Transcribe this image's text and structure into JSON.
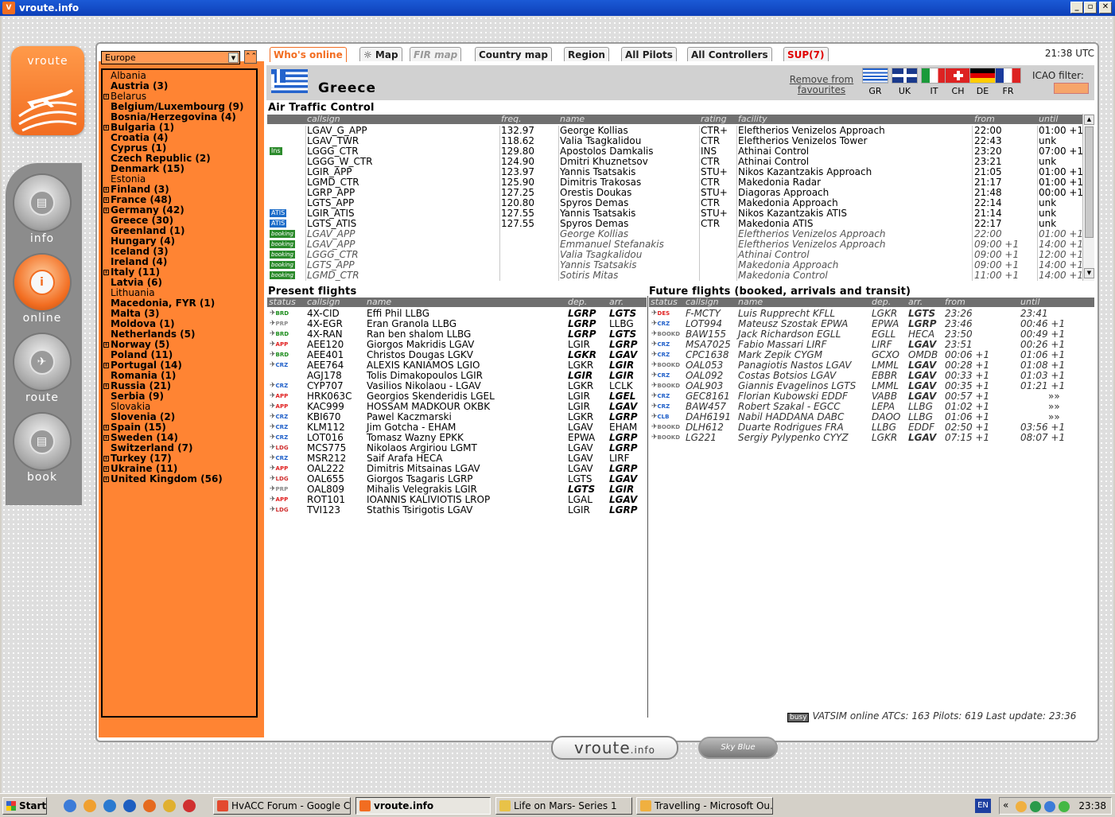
{
  "window": {
    "title": "vroute.info",
    "app_icon": "V"
  },
  "logo_text": "vroute",
  "nav": [
    {
      "label": "info",
      "glyph": "▤"
    },
    {
      "label": "online",
      "glyph": "i"
    },
    {
      "label": "route",
      "glyph": "✈"
    },
    {
      "label": "book",
      "glyph": "▤"
    }
  ],
  "region": {
    "selected": "Europe"
  },
  "regions": [
    {
      "name": "Albania",
      "bold": false,
      "exp": false
    },
    {
      "name": "Austria (3)",
      "bold": true,
      "exp": false
    },
    {
      "name": "Belarus",
      "bold": false,
      "exp": true
    },
    {
      "name": "Belgium/Luxembourg (9)",
      "bold": true,
      "exp": false
    },
    {
      "name": "Bosnia/Herzegovina (4)",
      "bold": true,
      "exp": false
    },
    {
      "name": "Bulgaria (1)",
      "bold": true,
      "exp": true
    },
    {
      "name": "Croatia (4)",
      "bold": true,
      "exp": false
    },
    {
      "name": "Cyprus (1)",
      "bold": true,
      "exp": false
    },
    {
      "name": "Czech Republic (2)",
      "bold": true,
      "exp": false
    },
    {
      "name": "Denmark (15)",
      "bold": true,
      "exp": false
    },
    {
      "name": "Estonia",
      "bold": false,
      "exp": false
    },
    {
      "name": "Finland (3)",
      "bold": true,
      "exp": true
    },
    {
      "name": "France (48)",
      "bold": true,
      "exp": true
    },
    {
      "name": "Germany (42)",
      "bold": true,
      "exp": true
    },
    {
      "name": "Greece (30)",
      "bold": true,
      "exp": false
    },
    {
      "name": "Greenland (1)",
      "bold": true,
      "exp": false
    },
    {
      "name": "Hungary (4)",
      "bold": true,
      "exp": false
    },
    {
      "name": "Iceland (3)",
      "bold": true,
      "exp": false
    },
    {
      "name": "Ireland (4)",
      "bold": true,
      "exp": false
    },
    {
      "name": "Italy (11)",
      "bold": true,
      "exp": true
    },
    {
      "name": "Latvia (6)",
      "bold": true,
      "exp": false
    },
    {
      "name": "Lithuania",
      "bold": false,
      "exp": false
    },
    {
      "name": "Macedonia, FYR (1)",
      "bold": true,
      "exp": false
    },
    {
      "name": "Malta (3)",
      "bold": true,
      "exp": false
    },
    {
      "name": "Moldova (1)",
      "bold": true,
      "exp": false
    },
    {
      "name": "Netherlands (5)",
      "bold": true,
      "exp": false
    },
    {
      "name": "Norway (5)",
      "bold": true,
      "exp": true
    },
    {
      "name": "Poland (11)",
      "bold": true,
      "exp": false
    },
    {
      "name": "Portugal (14)",
      "bold": true,
      "exp": true
    },
    {
      "name": "Romania (1)",
      "bold": true,
      "exp": false
    },
    {
      "name": "Russia (21)",
      "bold": true,
      "exp": true
    },
    {
      "name": "Serbia (9)",
      "bold": true,
      "exp": false
    },
    {
      "name": "Slovakia",
      "bold": false,
      "exp": false
    },
    {
      "name": "Slovenia (2)",
      "bold": true,
      "exp": false
    },
    {
      "name": "Spain (15)",
      "bold": true,
      "exp": true
    },
    {
      "name": "Sweden (14)",
      "bold": true,
      "exp": true
    },
    {
      "name": "Switzerland (7)",
      "bold": true,
      "exp": false
    },
    {
      "name": "Turkey (17)",
      "bold": true,
      "exp": true
    },
    {
      "name": "Ukraine (11)",
      "bold": true,
      "exp": true
    },
    {
      "name": "United Kingdom (56)",
      "bold": true,
      "exp": true
    }
  ],
  "tabs": [
    {
      "label": "Who's online",
      "state": "act"
    },
    {
      "label": "☼ Map",
      "state": ""
    },
    {
      "label": "FIR map",
      "state": "dis"
    },
    {
      "label": "Country map",
      "state": ""
    },
    {
      "label": "Region",
      "state": ""
    },
    {
      "label": "All Pilots",
      "state": ""
    },
    {
      "label": "All Controllers",
      "state": ""
    },
    {
      "label": "SUP(7)",
      "state": "sup"
    }
  ],
  "utc": "21:38 UTC",
  "header": {
    "country": "Greece",
    "remove": "Remove from favourites",
    "icao_label": "ICAO filter:",
    "favourites": [
      {
        "code": "GR"
      },
      {
        "code": "UK"
      },
      {
        "code": "IT"
      },
      {
        "code": "CH"
      },
      {
        "code": "DE"
      },
      {
        "code": "FR"
      }
    ]
  },
  "atc": {
    "title": "Air Traffic Control",
    "columns": [
      "callsign",
      "freq.",
      "name",
      "rating",
      "facility",
      "from",
      "until"
    ],
    "rows": [
      {
        "badge": "",
        "callsign": "LGAV_G_APP",
        "freq": "132.97",
        "name": "George Kollias",
        "rating": "CTR+",
        "facility": "Eleftherios Venizelos Approach",
        "from": "22:00",
        "until": "01:00 +1",
        "booking": false
      },
      {
        "badge": "",
        "callsign": "LGAV_TWR",
        "freq": "118.62",
        "name": "Valia Tsagkalidou",
        "rating": "CTR",
        "facility": "Eleftherios Venizelos Tower",
        "from": "22:43",
        "until": "unk",
        "booking": false
      },
      {
        "badge": "Ins",
        "callsign": "LGGG_CTR",
        "freq": "129.80",
        "name": "Apostolos Damkalis",
        "rating": "INS",
        "facility": "Athinai Control",
        "from": "23:20",
        "until": "07:00 +1",
        "booking": false
      },
      {
        "badge": "",
        "callsign": "LGGG_W_CTR",
        "freq": "124.90",
        "name": "Dmitri Khuznetsov",
        "rating": "CTR",
        "facility": "Athinai Control",
        "from": "23:21",
        "until": "unk",
        "booking": false
      },
      {
        "badge": "",
        "callsign": "LGIR_APP",
        "freq": "123.97",
        "name": "Yannis Tsatsakis",
        "rating": "STU+",
        "facility": "Nikos Kazantzakis Approach",
        "from": "21:05",
        "until": "01:00 +1",
        "booking": false
      },
      {
        "badge": "",
        "callsign": "LGMD_CTR",
        "freq": "125.90",
        "name": "Dimitris Trakosas",
        "rating": "CTR",
        "facility": "Makedonia Radar",
        "from": "21:17",
        "until": "01:00 +1",
        "booking": false
      },
      {
        "badge": "",
        "callsign": "LGRP_APP",
        "freq": "127.25",
        "name": "Orestis Doukas",
        "rating": "STU+",
        "facility": "Diagoras Approach",
        "from": "21:48",
        "until": "00:00 +1",
        "booking": false
      },
      {
        "badge": "",
        "callsign": "LGTS_APP",
        "freq": "120.80",
        "name": "Spyros Demas",
        "rating": "CTR",
        "facility": "Makedonia Approach",
        "from": "22:14",
        "until": "unk",
        "booking": false
      },
      {
        "badge": "ATIS",
        "callsign": "LGIR_ATIS",
        "freq": "127.55",
        "name": "Yannis Tsatsakis",
        "rating": "STU+",
        "facility": "Nikos Kazantzakis ATIS",
        "from": "21:14",
        "until": "unk",
        "booking": false
      },
      {
        "badge": "ATIS",
        "callsign": "LGTS_ATIS",
        "freq": "127.55",
        "name": "Spyros Demas",
        "rating": "CTR",
        "facility": "Makedonia ATIS",
        "from": "22:17",
        "until": "unk",
        "booking": false
      },
      {
        "badge": "booking",
        "callsign": "LGAV_APP",
        "freq": "",
        "name": "George Kollias",
        "rating": "",
        "facility": "Eleftherios Venizelos Approach",
        "from": "22:00",
        "until": "01:00 +1",
        "booking": true
      },
      {
        "badge": "booking",
        "callsign": "LGAV_APP",
        "freq": "",
        "name": "Emmanuel Stefanakis",
        "rating": "",
        "facility": "Eleftherios Venizelos Approach",
        "from": "09:00 +1",
        "until": "14:00 +1",
        "booking": true
      },
      {
        "badge": "booking",
        "callsign": "LGGG_CTR",
        "freq": "",
        "name": "Valia Tsagkalidou",
        "rating": "",
        "facility": "Athinai Control",
        "from": "09:00 +1",
        "until": "12:00 +1",
        "booking": true
      },
      {
        "badge": "booking",
        "callsign": "LGTS_APP",
        "freq": "",
        "name": "Yannis Tsatsakis",
        "rating": "",
        "facility": "Makedonia Approach",
        "from": "09:00 +1",
        "until": "14:00 +1",
        "booking": true
      },
      {
        "badge": "booking",
        "callsign": "LGMD_CTR",
        "freq": "",
        "name": "Sotiris Mitas",
        "rating": "",
        "facility": "Makedonia Control",
        "from": "11:00 +1",
        "until": "14:00 +1",
        "booking": true
      }
    ]
  },
  "present": {
    "title": "Present flights",
    "columns": [
      "status",
      "callsign",
      "name",
      "dep.",
      "arr."
    ],
    "rows": [
      {
        "status": "BRD",
        "callsign": "4X-CID",
        "name": "Effi Phil LLBG",
        "dep": "LGRP",
        "arr": "LGTS",
        "depb": true,
        "arrb": true
      },
      {
        "status": "PRP",
        "callsign": "4X-EGR",
        "name": "Eran Granola LLBG",
        "dep": "LGRP",
        "arr": "LLBG",
        "depb": true,
        "arrb": false
      },
      {
        "status": "BRD",
        "callsign": "4X-RAN",
        "name": "Ran ben shalom LLBG",
        "dep": "LGRP",
        "arr": "LGTS",
        "depb": true,
        "arrb": true
      },
      {
        "status": "APP",
        "callsign": "AEE120",
        "name": "Giorgos Makridis LGAV",
        "dep": "LGIR",
        "arr": "LGRP",
        "depb": false,
        "arrb": true
      },
      {
        "status": "BRD",
        "callsign": "AEE401",
        "name": "Christos Dougas LGKV",
        "dep": "LGKR",
        "arr": "LGAV",
        "depb": true,
        "arrb": true
      },
      {
        "status": "CRZ",
        "callsign": "AEE764",
        "name": "ALEXIS KANIAMOS LGIO",
        "dep": "LGKR",
        "arr": "LGIR",
        "depb": false,
        "arrb": true
      },
      {
        "status": "",
        "callsign": "AGJ178",
        "name": "Tolis Dimakopoulos LGIR",
        "dep": "LGIR",
        "arr": "LGIR",
        "depb": true,
        "arrb": true
      },
      {
        "status": "CRZ",
        "callsign": "CYP707",
        "name": "Vasilios Nikolaou - LGAV",
        "dep": "LGKR",
        "arr": "LCLK",
        "depb": false,
        "arrb": false
      },
      {
        "status": "APP",
        "callsign": "HRK063C",
        "name": "Georgios Skenderidis LGEL",
        "dep": "LGIR",
        "arr": "LGEL",
        "depb": false,
        "arrb": true
      },
      {
        "status": "APP",
        "callsign": "KAC999",
        "name": "HOSSAM MADKOUR OKBK",
        "dep": "LGIR",
        "arr": "LGAV",
        "depb": false,
        "arrb": true
      },
      {
        "status": "CRZ",
        "callsign": "KBI670",
        "name": "Pawel Kaczmarski",
        "dep": "LGKR",
        "arr": "LGRP",
        "depb": false,
        "arrb": true
      },
      {
        "status": "CRZ",
        "callsign": "KLM112",
        "name": "Jim Gotcha - EHAM",
        "dep": "LGAV",
        "arr": "EHAM",
        "depb": false,
        "arrb": false
      },
      {
        "status": "CRZ",
        "callsign": "LOT016",
        "name": "Tomasz Wazny EPKK",
        "dep": "EPWA",
        "arr": "LGRP",
        "depb": false,
        "arrb": true
      },
      {
        "status": "LDG",
        "callsign": "MCS775",
        "name": "Nikolaos Argiriou LGMT",
        "dep": "LGAV",
        "arr": "LGRP",
        "depb": false,
        "arrb": true
      },
      {
        "status": "CRZ",
        "callsign": "MSR212",
        "name": "Saif Arafa HECA",
        "dep": "LGAV",
        "arr": "LIRF",
        "depb": false,
        "arrb": false
      },
      {
        "status": "APP",
        "callsign": "OAL222",
        "name": "Dimitris Mitsainas LGAV",
        "dep": "LGAV",
        "arr": "LGRP",
        "depb": false,
        "arrb": true
      },
      {
        "status": "LDG",
        "callsign": "OAL655",
        "name": "Giorgos Tsagaris LGRP",
        "dep": "LGTS",
        "arr": "LGAV",
        "depb": false,
        "arrb": true
      },
      {
        "status": "PRP",
        "callsign": "OAL809",
        "name": "Mihalis Velegrakis LGIR",
        "dep": "LGTS",
        "arr": "LGIR",
        "depb": true,
        "arrb": true
      },
      {
        "status": "APP",
        "callsign": "ROT101",
        "name": "IOANNIS KALIVIOTIS LROP",
        "dep": "LGAL",
        "arr": "LGAV",
        "depb": false,
        "arrb": true
      },
      {
        "status": "LDG",
        "callsign": "TVI123",
        "name": "Stathis Tsirigotis LGAV",
        "dep": "LGIR",
        "arr": "LGRP",
        "depb": false,
        "arrb": true
      }
    ]
  },
  "future": {
    "title": "Future flights (booked, arrivals and transit)",
    "columns": [
      "status",
      "callsign",
      "name",
      "dep.",
      "arr.",
      "from",
      "until"
    ],
    "rows": [
      {
        "status": "DES",
        "callsign": "F-MCTY",
        "name": "Luis Rupprecht KFLL",
        "dep": "LGKR",
        "arr": "LGTS",
        "from": "23:26",
        "until": "23:41",
        "depb": false,
        "arrb": true
      },
      {
        "status": "CRZ",
        "callsign": "LOT994",
        "name": "Mateusz Szostak EPWA",
        "dep": "EPWA",
        "arr": "LGRP",
        "from": "23:46",
        "until": "00:46 +1",
        "depb": false,
        "arrb": true
      },
      {
        "status": "BOOKD",
        "callsign": "BAW155",
        "name": "Jack Richardson EGLL",
        "dep": "EGLL",
        "arr": "HECA",
        "from": "23:50",
        "until": "00:49 +1",
        "depb": false,
        "arrb": false
      },
      {
        "status": "CRZ",
        "callsign": "MSA7025",
        "name": "Fabio Massari LIRF",
        "dep": "LIRF",
        "arr": "LGAV",
        "from": "23:51",
        "until": "00:26 +1",
        "depb": false,
        "arrb": true
      },
      {
        "status": "CRZ",
        "callsign": "CPC1638",
        "name": "Mark Zepik CYGM",
        "dep": "GCXO",
        "arr": "OMDB",
        "from": "00:06 +1",
        "until": "01:06 +1",
        "depb": false,
        "arrb": false
      },
      {
        "status": "BOOKD",
        "callsign": "OAL053",
        "name": "Panagiotis Nastos LGAV",
        "dep": "LMML",
        "arr": "LGAV",
        "from": "00:28 +1",
        "until": "01:08 +1",
        "depb": false,
        "arrb": true
      },
      {
        "status": "CRZ",
        "callsign": "OAL092",
        "name": "Costas Botsios LGAV",
        "dep": "EBBR",
        "arr": "LGAV",
        "from": "00:33 +1",
        "until": "01:03 +1",
        "depb": false,
        "arrb": true
      },
      {
        "status": "BOOKD",
        "callsign": "OAL903",
        "name": "Giannis Evagelinos LGTS",
        "dep": "LMML",
        "arr": "LGAV",
        "from": "00:35 +1",
        "until": "01:21 +1",
        "depb": false,
        "arrb": true
      },
      {
        "status": "CRZ",
        "callsign": "GEC8161",
        "name": "Florian Kubowski EDDF",
        "dep": "VABB",
        "arr": "LGAV",
        "from": "00:57 +1",
        "until": "»»",
        "depb": false,
        "arrb": true
      },
      {
        "status": "CRZ",
        "callsign": "BAW457",
        "name": "Robert Szakal - EGCC",
        "dep": "LEPA",
        "arr": "LLBG",
        "from": "01:02 +1",
        "until": "»»",
        "depb": false,
        "arrb": false
      },
      {
        "status": "CLB",
        "callsign": "DAH6191",
        "name": "Nabil HADDANA DABC",
        "dep": "DAOO",
        "arr": "LLBG",
        "from": "01:06 +1",
        "until": "»»",
        "depb": false,
        "arrb": false
      },
      {
        "status": "BOOKD",
        "callsign": "DLH612",
        "name": "Duarte Rodrigues FRA",
        "dep": "LLBG",
        "arr": "EDDF",
        "from": "02:50 +1",
        "until": "03:56 +1",
        "depb": false,
        "arrb": false
      },
      {
        "status": "BOOKD",
        "callsign": "LG221",
        "name": "Sergiy Pylypenko CYYZ",
        "dep": "LGKR",
        "arr": "LGAV",
        "from": "07:15 +1",
        "until": "08:07 +1",
        "depb": false,
        "arrb": true
      }
    ]
  },
  "footer": {
    "busy": "busy",
    "text": "VATSIM online ATCs: 163 Pilots: 619 Last update: 23:36"
  },
  "bottom": {
    "logo": "vroute",
    "logo_suffix": ".info",
    "sky": "Sky Blue"
  },
  "taskbar": {
    "start": "Start",
    "lang": "EN",
    "time": "23:38",
    "tasks": [
      {
        "label": "HvACC Forum - Google C...",
        "active": false,
        "color": "#e34a2f"
      },
      {
        "label": "vroute.info",
        "active": true,
        "color": "#f26d21"
      },
      {
        "label": "Life on Mars- Series 1",
        "active": false,
        "color": "#e8c248"
      },
      {
        "label": "Travelling - Microsoft Ou...",
        "active": false,
        "color": "#f0b040"
      }
    ]
  }
}
